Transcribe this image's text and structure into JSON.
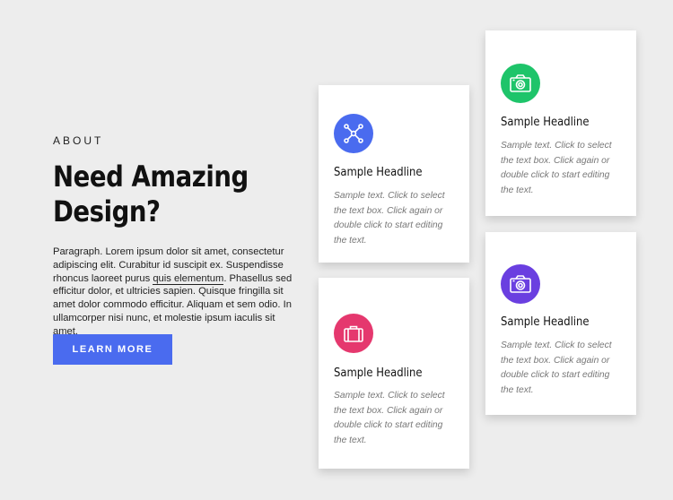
{
  "intro": {
    "eyebrow": "ABOUT",
    "heading_line1": "Need Amazing",
    "heading_line2": "Design?",
    "paragraph_before": "Paragraph. Lorem ipsum dolor sit amet, consectetur adipiscing elit. Curabitur id suscipit ex. Suspendisse rhoncus laoreet purus ",
    "paragraph_link": "quis elementum",
    "paragraph_after": ". Phasellus sed efficitur dolor, et ultricies sapien. Quisque fringilla sit amet dolor commodo efficitur. Aliquam et sem odio. In ullamcorper nisi nunc, et molestie ipsum iaculis sit amet.",
    "button_label": "LEARN MORE"
  },
  "cards": [
    {
      "icon": "network-icon",
      "color": "#4a6bef",
      "title": "Sample Headline",
      "text": "Sample text. Click to select the text box. Click again or double click to start editing the text."
    },
    {
      "icon": "camera-icon",
      "color": "#1ec46a",
      "title": "Sample Headline",
      "text": "Sample text. Click to select the text box. Click again or double click to start editing the text."
    },
    {
      "icon": "briefcase-icon",
      "color": "#e5386e",
      "title": "Sample Headline",
      "text": "Sample text. Click to select the text box. Click again or double click to start editing the text."
    },
    {
      "icon": "camera-icon",
      "color": "#6a3fe0",
      "title": "Sample Headline",
      "text": "Sample text. Click to select the text box. Click again or double click to start editing the text."
    }
  ],
  "colors": {
    "background": "#ededed",
    "button": "#4a6bef",
    "card": "#ffffff"
  }
}
